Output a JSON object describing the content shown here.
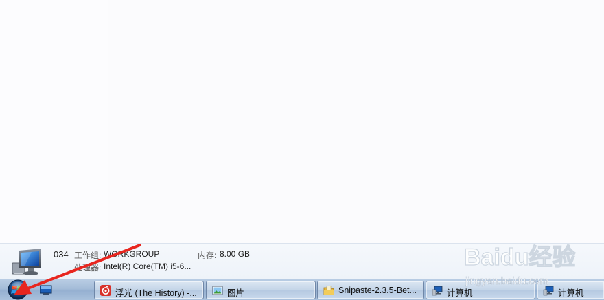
{
  "details_pane": {
    "computer_name": "034",
    "workgroup_label": "工作组:",
    "workgroup_value": "WORKGROUP",
    "memory_label": "内存:",
    "memory_value": "8.00 GB",
    "processor_label": "处理器:",
    "processor_value": "Intel(R) Core(TM) i5-6..."
  },
  "taskbar": {
    "start_button": "start-orb-icon",
    "buttons": [
      {
        "label": "浮光 (The History) -...",
        "icon": "netease-music-icon"
      },
      {
        "label": "图片",
        "icon": "picture-viewer-icon"
      },
      {
        "label": "Snipaste-2.3.5-Bet...",
        "icon": "folder-icon"
      },
      {
        "label": "计算机",
        "icon": "computer-icon"
      },
      {
        "label": "计算机",
        "icon": "computer-icon"
      }
    ]
  },
  "colors": {
    "annotation_arrow": "#e8261f",
    "taskbar": "#a4bcd8",
    "netease_red": "#d8312a"
  },
  "watermark": {
    "brand": "Baidu经验",
    "url": "jingyan.baidu.com"
  }
}
